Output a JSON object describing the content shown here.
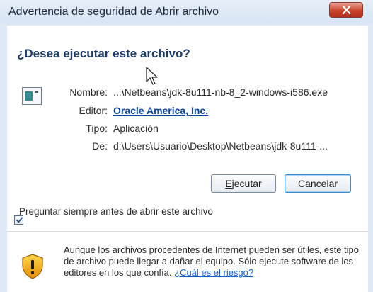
{
  "window": {
    "title": "Advertencia de seguridad de Abrir archivo"
  },
  "dialog": {
    "heading": "¿Desea ejecutar este archivo?",
    "fields": {
      "name_label": "Nombre:",
      "name_value": "...\\Netbeans\\jdk-8u111-nb-8_2-windows-i586.exe",
      "publisher_label": "Editor:",
      "publisher_value": "Oracle America, Inc.",
      "type_label": "Tipo:",
      "type_value": "Aplicación",
      "from_label": "De:",
      "from_value": "d:\\Users\\Usuario\\Desktop\\Netbeans\\jdk-8u111-..."
    },
    "buttons": {
      "run_first": "E",
      "run_rest": "jecutar",
      "cancel": "Cancelar"
    },
    "checkbox": {
      "label": "Preguntar siempre antes de abrir este archivo",
      "checked": true
    },
    "warning": {
      "text": "Aunque los archivos procedentes de Internet pueden ser útiles, este tipo de archivo puede llegar a dañar el equipo. Sólo ejecute software de los editores en los que confía.",
      "link": "¿Cuál es el riesgo?"
    }
  },
  "colors": {
    "heading": "#1f3d66",
    "link": "#0b46a8",
    "close": "#c9432b"
  }
}
